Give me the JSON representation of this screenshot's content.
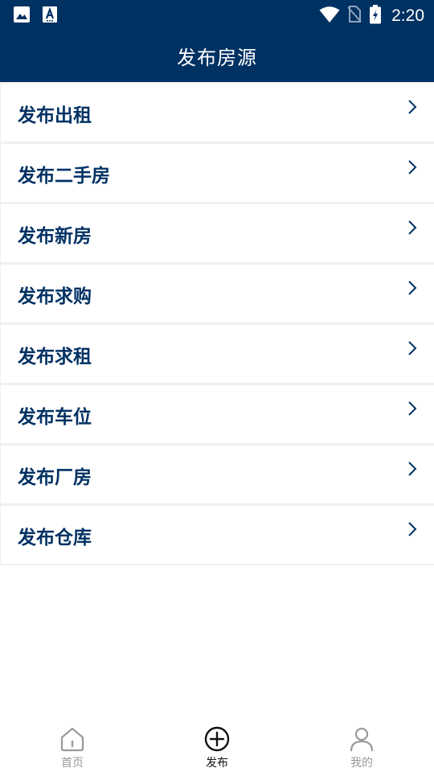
{
  "status_bar": {
    "time": "2:20",
    "left_icons": [
      "image-icon",
      "text-a-icon"
    ],
    "right_icons": [
      "wifi-icon",
      "no-sim-icon",
      "battery-charging-icon"
    ]
  },
  "header": {
    "title": "发布房源",
    "background_color": "#003163"
  },
  "menu": {
    "items": [
      {
        "label": "发布出租"
      },
      {
        "label": "发布二手房"
      },
      {
        "label": "发布新房"
      },
      {
        "label": "发布求购"
      },
      {
        "label": "发布求租"
      },
      {
        "label": "发布车位"
      },
      {
        "label": "发布厂房"
      },
      {
        "label": "发布仓库"
      }
    ],
    "label_color": "#003163",
    "chevron_icon": "chevron-right-icon"
  },
  "bottom_nav": {
    "tabs": [
      {
        "label": "首页",
        "icon": "home-icon",
        "active": false
      },
      {
        "label": "发布",
        "icon": "add-circle-icon",
        "active": true
      },
      {
        "label": "我的",
        "icon": "person-icon",
        "active": false
      }
    ],
    "active_color": "#111111",
    "inactive_color": "#9a9a9a"
  }
}
